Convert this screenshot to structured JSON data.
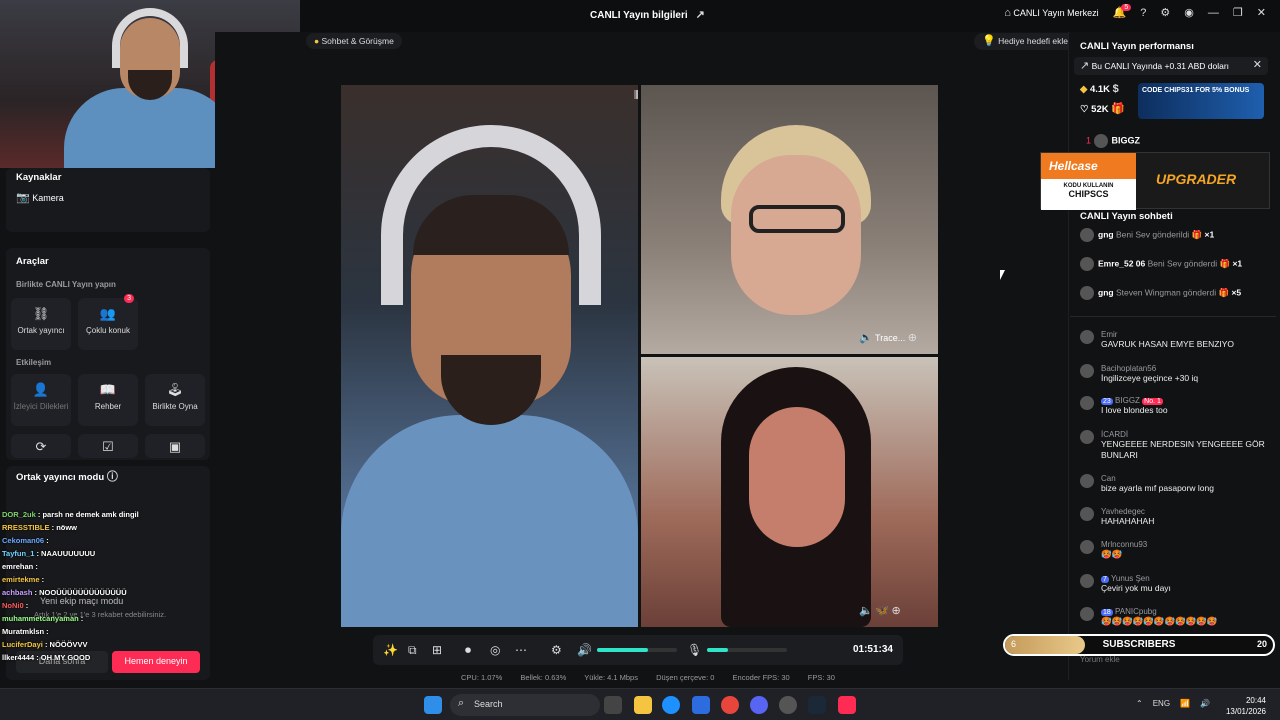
{
  "topbar": {
    "title": "CANLI Yayın bilgileri",
    "live_center": "CANLI Yayın Merkezi",
    "notif_count": "5"
  },
  "stage": {
    "pill": "Sohbet & Görüşme",
    "goal": "Hediye hedefi ekle",
    "guest_label": "Trace...",
    "timer": "01:51:34"
  },
  "stats": {
    "cpu": "CPU: 1.07%",
    "mem": "Bellek: 0.63%",
    "upload": "Yükle: 4.1 Mbps",
    "drop": "Düşen çerçeve: 0",
    "enc_fps": "Encoder FPS: 30",
    "fps": "FPS: 30"
  },
  "left": {
    "sources_title": "Kaynaklar",
    "camera": "Kamera",
    "tools_title": "Araçlar",
    "collab_title": "Birlikte CANLI Yayın yapın",
    "co_host": "Ortak yayıncı",
    "multi_guest": "Çoklu konuk",
    "multi_badge": "3",
    "engage_title": "Etkileşim",
    "viewer_wishes": "İzleyici Dilekleri",
    "guide": "Rehber",
    "play_together": "Birlikte Oyna",
    "cohost_mode": "Ortak yayıncı modu",
    "overlay_info": "Yeni ekip maçı modu",
    "overlay_info2": "Artık 1'e 2 ve 1'e 3 rekabet edebilirsiniz.",
    "later": "Daha sonra",
    "try_now": "Hemen deneyin"
  },
  "overlay_chat": [
    {
      "u": "DOR_2uk",
      "m": "parsh ne demek amk dingil",
      "c": "#7fd36b"
    },
    {
      "u": "RRESSTIBLE",
      "m": "nöww",
      "c": "#f5c542"
    },
    {
      "u": "Cekoman06",
      "m": "",
      "c": "#6aa8ff"
    },
    {
      "u": "Tayfun_1",
      "m": "NAAUUUUUUU",
      "c": "#6fd3ff"
    },
    {
      "u": "emrehan",
      "m": "",
      "c": "#ffffff"
    },
    {
      "u": "emirtekme",
      "m": "",
      "c": "#f5c542"
    },
    {
      "u": "achbash",
      "m": "NOOÜÜÜÜÜÜÜÜÜÜÜÜÜ",
      "c": "#c7a1ff"
    },
    {
      "u": "NoNi0",
      "m": "",
      "c": "#ff5a5a"
    },
    {
      "u": "muhammetcanyaman",
      "m": "",
      "c": "#9aff8a"
    },
    {
      "u": "Muratmklsn",
      "m": "",
      "c": "#ffffff"
    },
    {
      "u": "LuciferDayi",
      "m": "NÖÖÖVVV",
      "c": "#f5c542"
    },
    {
      "u": "llker4444",
      "m": "OH MY GOOD",
      "c": "#ffffff"
    }
  ],
  "right": {
    "perf_title": "CANLI Yayın performansı",
    "earn_notice": "Bu CANLI Yayında +0.31 ABD doları",
    "diamonds": "4.1K",
    "likes": "52K",
    "code_ad": "CODE CHIPS31 FOR 5% BONUS",
    "top_name": "BIGGZ",
    "top_rank": "1",
    "hell_brand": "Hellcase",
    "hell_sub": "KODU KULLANIN",
    "hell_code": "CHIPSCS",
    "hell_up": "UPGRADER",
    "chat_title": "CANLI Yayın sohbeti",
    "gifts": [
      {
        "n": "gng",
        "d": "Beni Sev gönderildi",
        "x": "×1"
      },
      {
        "n": "Emre_52 06",
        "d": "Beni Sev gönderdi",
        "x": "×1"
      },
      {
        "n": "gng",
        "d": "Steven Wingman gönderdi",
        "x": "×5"
      }
    ],
    "comments": [
      {
        "u": "Emir",
        "t": "GAVRUK HASAN EMYE BENZIYO"
      },
      {
        "u": "Bacihoplatan56",
        "t": "İngilizceye geçince +30 iq"
      },
      {
        "u": "BIGGZ",
        "t": "I love blondes too",
        "lv": "23",
        "no1": "No. 1"
      },
      {
        "u": "İCARDİ",
        "t": "YENGEEEE NERDESIN YENGEEEE GÖR BUNLARI"
      },
      {
        "u": "Can",
        "t": "bize ayarla mıf pasaporw long"
      },
      {
        "u": "Yavhedegec",
        "t": "HAHAHAHAH"
      },
      {
        "u": "Mrlnconnu93",
        "t": "🥵🥵"
      },
      {
        "u": "Yunus Şen",
        "t": "Çeviri yok mu dayı",
        "lv": "7"
      },
      {
        "u": "PANICpubg",
        "t": "🥵🥵🥵🥵🥵🥵🥵🥵🥵🥵🥵",
        "lv": "18"
      }
    ],
    "sub_label": "SUBSCRIBERS",
    "sub_current": "6",
    "sub_goal": "20",
    "sub_fraction": 0.3,
    "comment_placeholder": "Yorum ekle"
  },
  "taskbar": {
    "search": "Search",
    "lang": "ENG",
    "time": "20:44",
    "date": "13/01/2026"
  }
}
